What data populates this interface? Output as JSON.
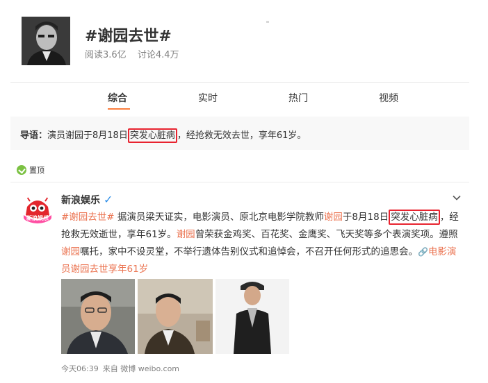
{
  "topic": {
    "title": "#谢园去世#",
    "reads": "阅读3.6亿",
    "discussions": "讨论4.4万"
  },
  "tabs": [
    {
      "label": "综合",
      "active": true
    },
    {
      "label": "实时",
      "active": false
    },
    {
      "label": "热门",
      "active": false
    },
    {
      "label": "视频",
      "active": false
    }
  ],
  "guide": {
    "label": "导语：",
    "text_before": "演员谢园于8月18日",
    "highlight": "突发心脏病",
    "text_after": "，经抢救无效去世，享年61岁。"
  },
  "pinned": {
    "label": "置顶"
  },
  "post": {
    "author": "新浪娱乐",
    "avatar_text": "新浪娱乐",
    "verified_icon": "verified-v-icon",
    "tag": "#谢园去世#",
    "seg1": " 据演员梁天证实，电影演员、原北京电影学院教师",
    "name1": "谢园",
    "seg2": "于8月18日",
    "highlight": "突发心脏病",
    "seg3": "，经抢救无效逝世，享年61岁。",
    "name2": "谢园",
    "seg4": "曾荣获金鸡奖、百花奖、金鹰奖、飞天奖等多个表演奖项。遵照",
    "name3": "谢园",
    "seg5": "嘱托，家中不设灵堂，不举行遗体告别仪式和追悼会，不召开任何形式的追思会。",
    "link_text": "电影演员谢园去世享年61岁",
    "time": "今天06:39",
    "source": "来自 微博 weibo.com"
  },
  "colors": {
    "accent": "#fa7d3c",
    "highlight_box": "#e8232f",
    "mention": "#eb7350",
    "verified": "#2f8fe8"
  }
}
